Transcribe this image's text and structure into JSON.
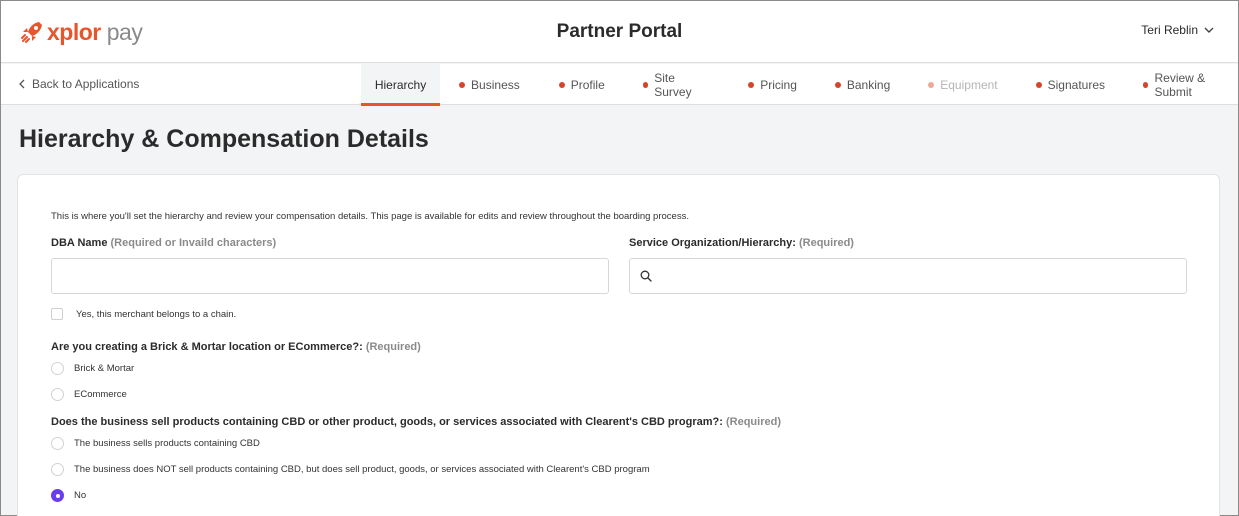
{
  "brand": {
    "logo_text_main": "xplor",
    "logo_text_secondary": "pay",
    "accent_color": "#e8552c",
    "logo_icon": "rocket-icon"
  },
  "header": {
    "title": "Partner Portal",
    "user_name": "Teri Reblin"
  },
  "nav": {
    "back_label": "Back to Applications",
    "steps": [
      {
        "label": "Hierarchy",
        "state": "active"
      },
      {
        "label": "Business",
        "state": "pending"
      },
      {
        "label": "Profile",
        "state": "pending"
      },
      {
        "label": "Site Survey",
        "state": "pending"
      },
      {
        "label": "Pricing",
        "state": "pending"
      },
      {
        "label": "Banking",
        "state": "pending"
      },
      {
        "label": "Equipment",
        "state": "disabled"
      },
      {
        "label": "Signatures",
        "state": "pending"
      },
      {
        "label": "Review & Submit",
        "state": "pending"
      }
    ]
  },
  "page": {
    "title": "Hierarchy & Compensation Details"
  },
  "form": {
    "intro": "This is where you'll set the hierarchy and review your compensation details. This page is available for edits and review throughout the boarding process.",
    "dba": {
      "label": "DBA Name",
      "requirement": "(Required or Invaild characters)",
      "value": ""
    },
    "hierarchy": {
      "label": "Service Organization/Hierarchy:",
      "requirement": "(Required)",
      "value": ""
    },
    "chain_checkbox": {
      "label": "Yes, this merchant belongs to a chain.",
      "checked": false
    },
    "location_question": {
      "label": "Are you creating a Brick & Mortar location or ECommerce?:",
      "requirement": "(Required)",
      "options": [
        "Brick & Mortar",
        "ECommerce"
      ],
      "selected": ""
    },
    "cbd_question": {
      "label": "Does the business sell products containing CBD or other product, goods, or services associated with Clearent's CBD program?:",
      "requirement": "(Required)",
      "options": [
        "The business sells products containing CBD",
        "The business does NOT sell products containing CBD, but does sell product, goods, or services associated with Clearent's CBD program",
        "No"
      ],
      "selected": "No"
    }
  },
  "colors": {
    "accent": "#e8552c",
    "step_dot": "#d6452a",
    "radio_selected": "#6b3df0"
  }
}
